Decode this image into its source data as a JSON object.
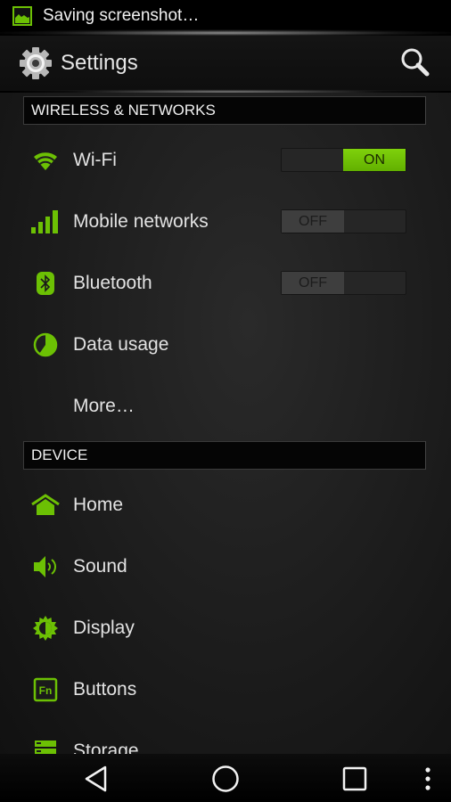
{
  "status_bar": {
    "notification_icon": "screenshot-image-icon",
    "notification_text": "Saving screenshot…"
  },
  "action_bar": {
    "app_icon": "gear-icon",
    "title": "Settings",
    "search_icon": "search-icon"
  },
  "sections": [
    {
      "header": "WIRELESS & NETWORKS",
      "items": [
        {
          "label": "Wi-Fi",
          "icon": "wifi-icon",
          "toggle": "ON"
        },
        {
          "label": "Mobile networks",
          "icon": "signal-bars-icon",
          "toggle": "OFF"
        },
        {
          "label": "Bluetooth",
          "icon": "bluetooth-icon",
          "toggle": "OFF"
        },
        {
          "label": "Data usage",
          "icon": "data-usage-icon"
        },
        {
          "label": "More…"
        }
      ]
    },
    {
      "header": "DEVICE",
      "items": [
        {
          "label": "Home",
          "icon": "home-icon"
        },
        {
          "label": "Sound",
          "icon": "speaker-icon"
        },
        {
          "label": "Display",
          "icon": "brightness-icon"
        },
        {
          "label": "Buttons",
          "icon": "fn-key-icon"
        },
        {
          "label": "Storage",
          "icon": "storage-icon"
        }
      ]
    }
  ],
  "nav_bar": {
    "back": "back-icon",
    "home": "home-circle-icon",
    "recents": "recents-icon",
    "menu": "overflow-menu-icon"
  },
  "colors": {
    "accent": "#6cc004",
    "background": "#1c1c1c",
    "text": "#e2e2e2"
  }
}
